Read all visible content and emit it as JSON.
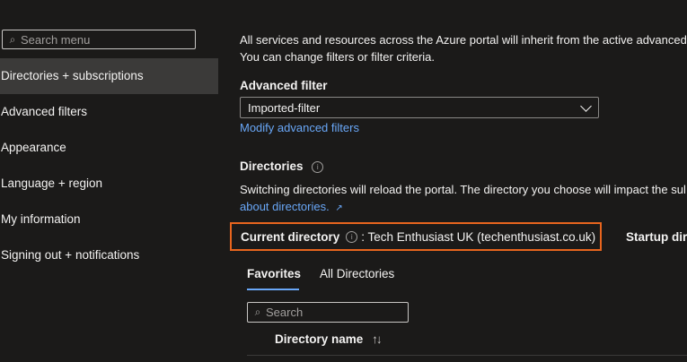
{
  "sidebar": {
    "search_placeholder": "Search menu",
    "items": [
      {
        "label": "Directories + subscriptions",
        "active": true
      },
      {
        "label": "Advanced filters"
      },
      {
        "label": "Appearance"
      },
      {
        "label": "Language + region"
      },
      {
        "label": "My information"
      },
      {
        "label": "Signing out + notifications"
      }
    ]
  },
  "main": {
    "intro_line1": "All services and resources across the Azure portal will inherit from the active advanced f",
    "intro_line2": "You can change filters or filter criteria.",
    "advanced_filter": {
      "heading": "Advanced filter",
      "selected": "Imported-filter",
      "modify_link": "Modify advanced filters"
    },
    "directories": {
      "heading": "Directories",
      "description": "Switching directories will reload the portal. The directory you choose will impact the sul",
      "about_link": "about directories."
    },
    "current_directory": {
      "label": "Current directory",
      "value": ": Tech Enthusiast UK (techenthusiast.co.uk)"
    },
    "startup_directory_label": "Startup dir",
    "tabs": [
      {
        "label": "Favorites",
        "active": true
      },
      {
        "label": "All Directories"
      }
    ],
    "directory_search_placeholder": "Search",
    "column_header": "Directory name"
  },
  "colors": {
    "background": "#1b1a19",
    "sidebar_active": "#3b3a39",
    "link": "#69a7f7",
    "highlight_border": "#e8651e"
  }
}
